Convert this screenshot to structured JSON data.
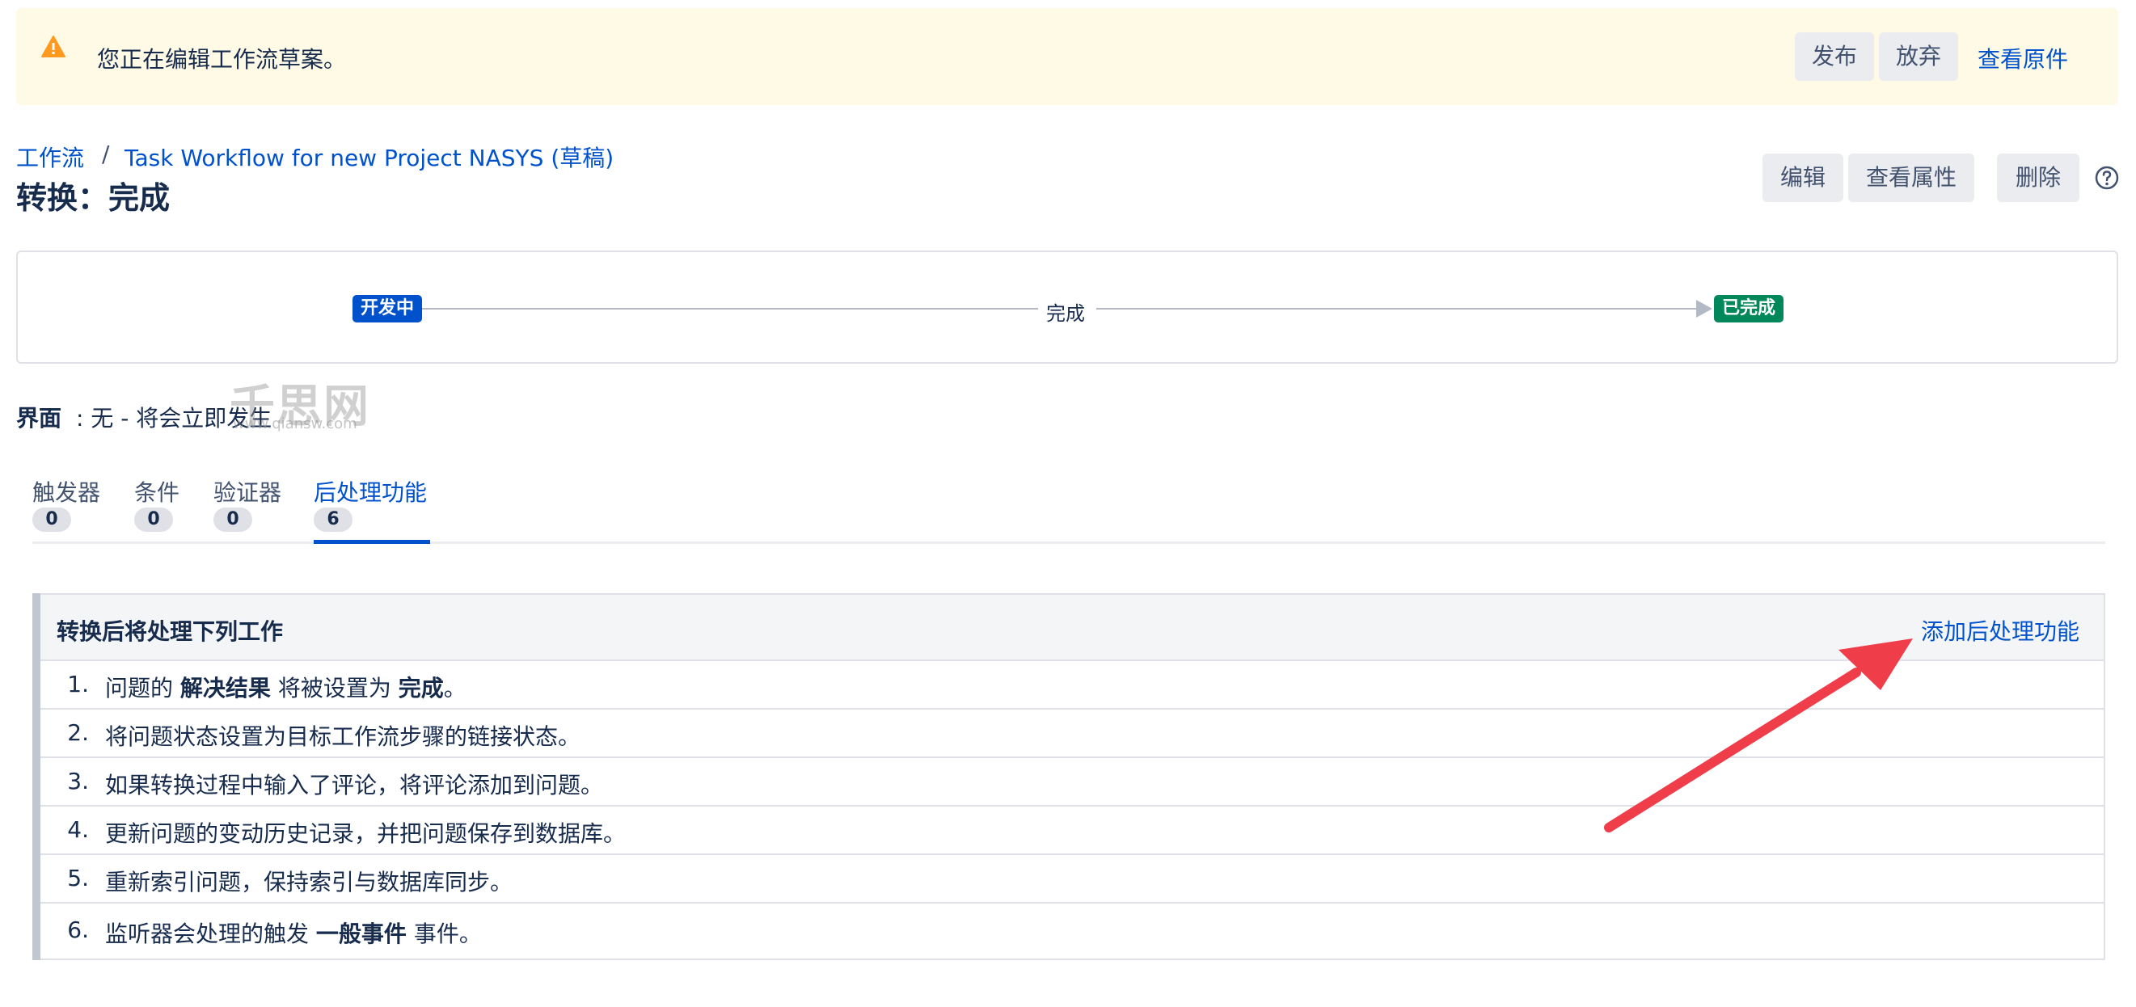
{
  "banner": {
    "message": "您正在编辑工作流草案。",
    "publish_label": "发布",
    "discard_label": "放弃",
    "view_original_label": "查看原件"
  },
  "breadcrumb": {
    "workflows": "工作流",
    "separator": "/",
    "workflow_name": "Task Workflow for new Project NASYS (草稿)"
  },
  "page_title": "转换：完成",
  "actions": {
    "edit_label": "编辑",
    "view_properties_label": "查看属性",
    "delete_label": "删除"
  },
  "diagram": {
    "from_status": "开发中",
    "transition": "完成",
    "to_status": "已完成"
  },
  "screen": {
    "label": "界面",
    "value": ": 无 - 将会立即发生"
  },
  "watermark": {
    "text": "千思网",
    "url": "www.qiansw.com"
  },
  "tabs": [
    {
      "label": "触发器",
      "count": "0"
    },
    {
      "label": "条件",
      "count": "0"
    },
    {
      "label": "验证器",
      "count": "0"
    },
    {
      "label": "后处理功能",
      "count": "6",
      "active": true
    }
  ],
  "post_functions": {
    "title": "转换后将处理下列工作",
    "add_label": "添加后处理功能",
    "items": [
      {
        "num": "1.",
        "pre": "问题的 ",
        "b1": "解决结果",
        "mid": " 将被设置为 ",
        "b2": "完成",
        "post": "。"
      },
      {
        "num": "2.",
        "pre": "将问题状态设置为目标工作流步骤的链接状态。"
      },
      {
        "num": "3.",
        "pre": "如果转换过程中输入了评论，将评论添加到问题。"
      },
      {
        "num": "4.",
        "pre": "更新问题的变动历史记录，并把问题保存到数据库。"
      },
      {
        "num": "5.",
        "pre": "重新索引问题，保持索引与数据库同步。"
      },
      {
        "num": "6.",
        "pre": "监听器会处理的触发 ",
        "b1": "一般事件",
        "post": " 事件。"
      }
    ]
  },
  "colors": {
    "link": "#0052cc",
    "banner_bg": "#fffae6",
    "warning": "#ff991f",
    "status_in_progress": "#0052cc",
    "status_done": "#00875a",
    "annotation_arrow": "#ef3e4a"
  }
}
